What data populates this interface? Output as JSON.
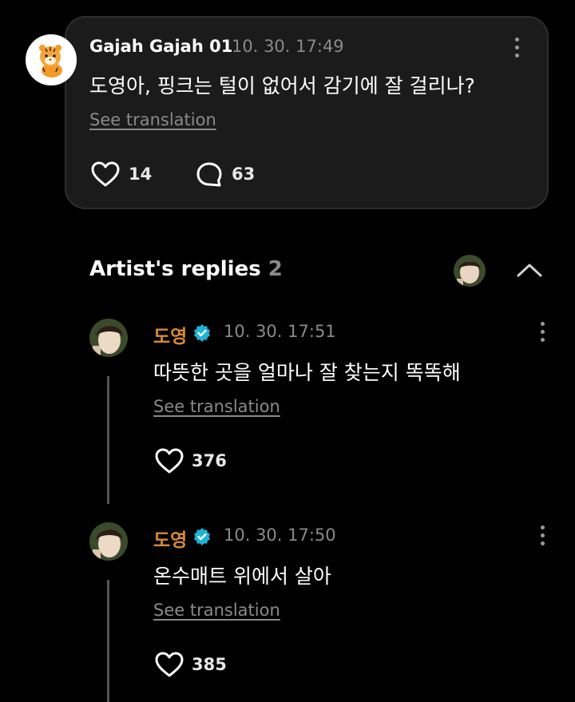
{
  "post": {
    "author": "Gajah Gajah 01",
    "time": "10. 30. 17:49",
    "text": "도영아, 핑크는 털이 없어서 감기에 잘 걸리나?",
    "see_translation": "See translation",
    "likes": "14",
    "comments": "63"
  },
  "replies_header": {
    "title": "Artist's replies",
    "count": "2"
  },
  "replies": [
    {
      "name": "도영",
      "time": "10. 30. 17:51",
      "text": "따뜻한 곳을 얼마나 잘 찾는지 똑똑해",
      "see_translation": "See translation",
      "likes": "376"
    },
    {
      "name": "도영",
      "time": "10. 30. 17:50",
      "text": "온수매트 위에서 살아",
      "see_translation": "See translation",
      "likes": "385"
    }
  ],
  "colors": {
    "artist_name": "#d98a3b",
    "verified_badge": "#1fb3d6",
    "card_bg": "#1b1b1b"
  },
  "icons": [
    "tiger-avatar-icon",
    "more-vertical-icon",
    "heart-icon",
    "comment-bubble-icon",
    "verified-badge-icon",
    "chevron-up-icon"
  ]
}
